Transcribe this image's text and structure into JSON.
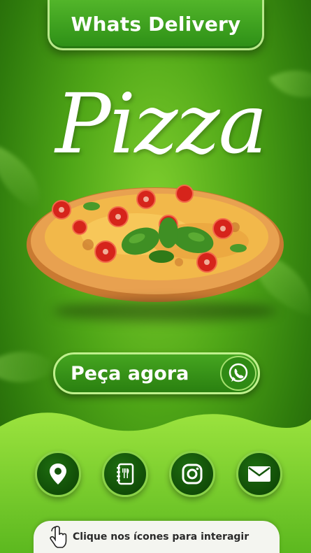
{
  "header": {
    "title": "Whats Delivery"
  },
  "hero": {
    "title": "Pizza"
  },
  "cta": {
    "label": "Peça agora",
    "icon": "whatsapp-icon"
  },
  "icons": [
    {
      "name": "location-pin-icon"
    },
    {
      "name": "menu-book-icon"
    },
    {
      "name": "instagram-icon"
    },
    {
      "name": "mail-icon"
    }
  ],
  "hint": {
    "text": "Clique nos ícones para interagir",
    "icon": "hand-pointer-icon"
  },
  "colors": {
    "bg_green": "#4fa617",
    "accent_light": "#8ad148",
    "dark_green": "#0f4806"
  }
}
